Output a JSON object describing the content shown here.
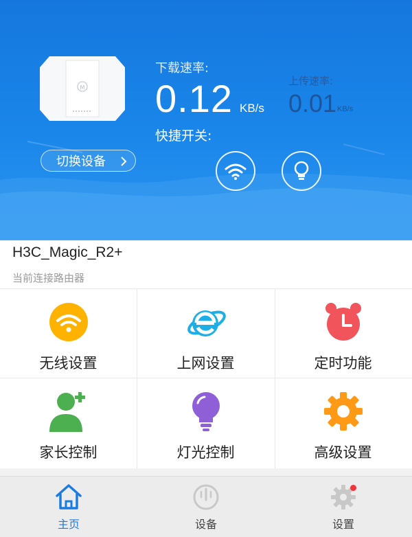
{
  "header": {
    "download_label": "下载速率:",
    "download_value": "0.12",
    "download_unit": "KB/s",
    "upload_label": "上传速率:",
    "upload_value": "0.01",
    "upload_unit": "KB/s",
    "quick_switch_label": "快捷开关:",
    "switch_device_label": "切换设备"
  },
  "device": {
    "name": "H3C_Magic_R2+",
    "subtitle": "当前连接路由器"
  },
  "features": [
    {
      "label": "无线设置",
      "icon": "wifi-icon",
      "color": "#ffb300"
    },
    {
      "label": "上网设置",
      "icon": "internet-explorer-icon",
      "color": "#1eaee6"
    },
    {
      "label": "定时功能",
      "icon": "alarm-clock-icon",
      "color": "#f2545b"
    },
    {
      "label": "家长控制",
      "icon": "parent-add-user-icon",
      "color": "#4caf50"
    },
    {
      "label": "灯光控制",
      "icon": "light-bulb-icon",
      "color": "#8e5fd6"
    },
    {
      "label": "高级设置",
      "icon": "gear-icon",
      "color": "#ff9a16"
    }
  ],
  "tabs": [
    {
      "label": "主页",
      "icon": "home-icon",
      "active": true
    },
    {
      "label": "设备",
      "icon": "device-icon",
      "active": false
    },
    {
      "label": "设置",
      "icon": "settings-gear-icon",
      "active": false
    }
  ],
  "colors": {
    "accent": "#1a7ce0",
    "header_blue": "#1a86ea",
    "badge_red": "#f0353d"
  }
}
